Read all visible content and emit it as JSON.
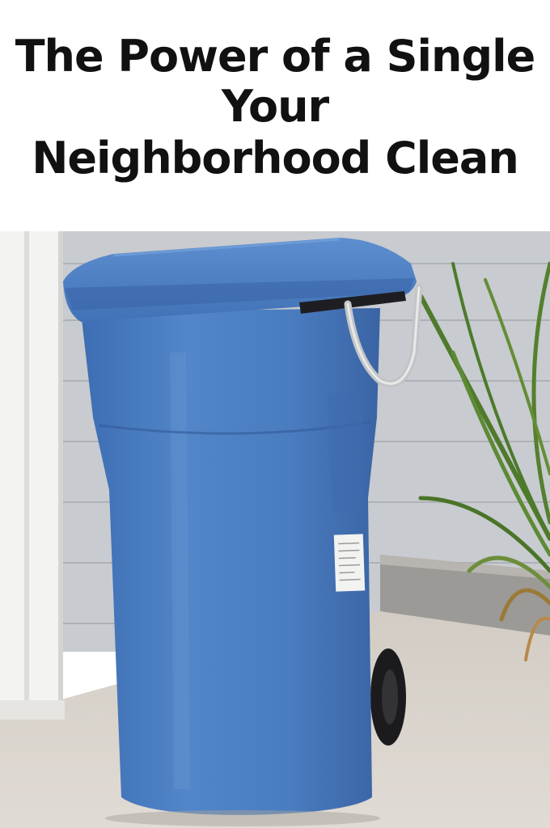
{
  "title": {
    "lines": [
      "The Power of a Single",
      "Your",
      "Neighborhood Clean"
    ]
  },
  "photo": {
    "subject": "blue wheeled trash bin beside house siding with potted plant",
    "colors": {
      "bin": "#4a7cc0",
      "bin_dark": "#3a66a8",
      "bin_light": "#6b98d4",
      "siding": "#c9ccd0",
      "ground": "#d8d3cc",
      "trim": "#f4f4f2",
      "plant": "#4f7a2c"
    }
  }
}
